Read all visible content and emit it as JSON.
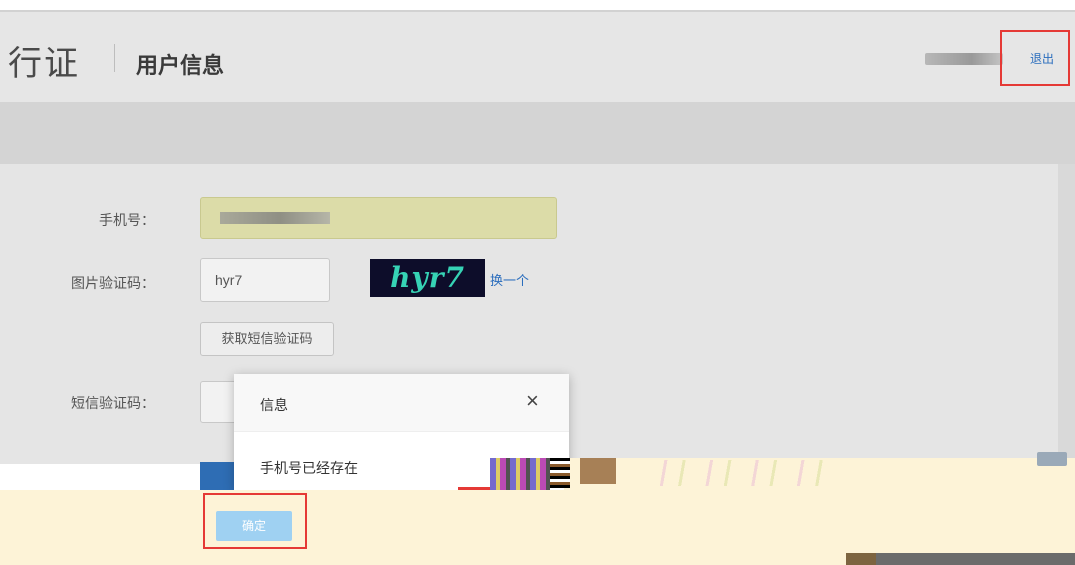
{
  "header": {
    "brand": "行证",
    "page_title": "用户信息",
    "logout_label": "退出"
  },
  "form": {
    "phone_label": "手机号：",
    "captcha_label": "图片验证码：",
    "captcha_value": "hyr7",
    "captcha_image_text": "hyr7",
    "swap_captcha_label": "换一个",
    "get_sms_button": "获取短信验证码",
    "sms_label": "短信验证码："
  },
  "dialog": {
    "title": "信息",
    "close_symbol": "×",
    "message": "手机号已经存在",
    "confirm_label": "确定"
  }
}
